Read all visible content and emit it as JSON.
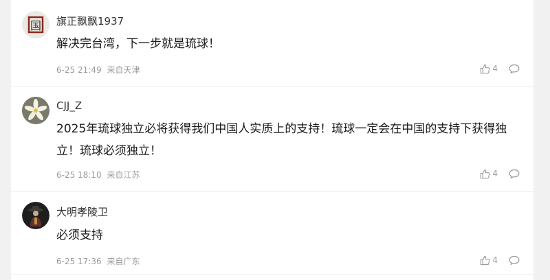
{
  "comments": [
    {
      "username": "旗正飘飘1937",
      "avatar_icon": "guo-character-avatar",
      "avatar_text": "国",
      "content": "解决完台湾，下一步就是琉球！",
      "date": "6-25 21:49",
      "location": "来自天津",
      "likes": "4"
    },
    {
      "username": "CJJ_Z",
      "avatar_icon": "lily-flower-avatar",
      "content": "2025年琉球独立必将获得我们中国人实质上的支持！琉球一定会在中国的支持下获得独立！琉球必须独立！",
      "date": "6-25 18:10",
      "location": "来自江苏",
      "likes": "4"
    },
    {
      "username": "大明孝陵卫",
      "avatar_icon": "ming-guard-avatar",
      "content": "必须支持",
      "date": "6-25 17:36",
      "location": "来自广东",
      "likes": "4"
    }
  ],
  "icons": {
    "like": "thumbs-up-icon",
    "reply": "speech-bubble-icon"
  },
  "colors": {
    "background": "#f1f1f1",
    "card": "#ffffff",
    "meta": "#999999",
    "divider": "#ebebeb"
  }
}
